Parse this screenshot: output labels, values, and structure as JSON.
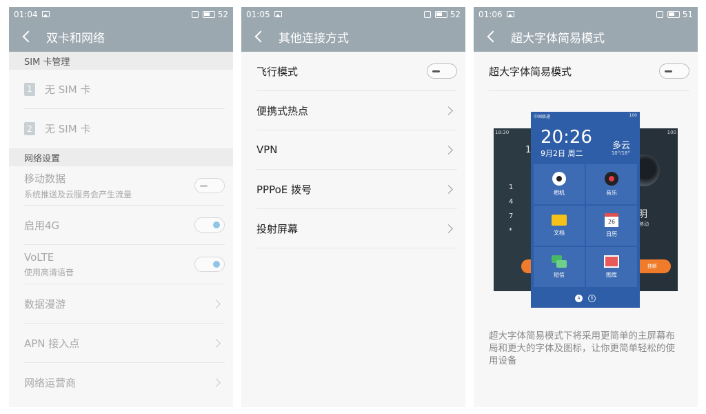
{
  "screens": [
    {
      "status": {
        "time": "01:04",
        "battery": "52"
      },
      "title": "双卡和网络",
      "sim_section": "SIM 卡管理",
      "sims": [
        {
          "slot": "1",
          "label": "无 SIM 卡"
        },
        {
          "slot": "2",
          "label": "无 SIM 卡"
        }
      ],
      "network_section": "网络设置",
      "items": [
        {
          "label": "移动数据",
          "sub": "系统推送及云服务会产生流量",
          "control": "toggle-off"
        },
        {
          "label": "启用4G",
          "control": "toggle-on"
        },
        {
          "label": "VoLTE",
          "sub": "使用高清语音",
          "control": "toggle-on"
        },
        {
          "label": "数据漫游",
          "control": "chevron"
        },
        {
          "label": "APN 接入点",
          "control": "chevron"
        },
        {
          "label": "网络运营商",
          "control": "chevron"
        }
      ]
    },
    {
      "status": {
        "time": "01:05",
        "battery": "52"
      },
      "title": "其他连接方式",
      "items": [
        {
          "label": "飞行模式",
          "control": "toggle-off"
        },
        {
          "label": "便携式热点",
          "control": "chevron"
        },
        {
          "label": "VPN",
          "control": "chevron"
        },
        {
          "label": "PPPoE 拨号",
          "control": "chevron"
        },
        {
          "label": "投射屏幕",
          "control": "chevron"
        }
      ]
    },
    {
      "status": {
        "time": "01:06",
        "battery": "51"
      },
      "title": "超大字体简易模式",
      "toggle_label": "超大字体简易模式",
      "preview": {
        "carrier": "中国联通",
        "signal": "100",
        "clock": "20:26",
        "date": "9月2日 周二",
        "weather": "多云",
        "temp": "10°/18°",
        "tiles": [
          {
            "label": "相机",
            "icon": "camera-icon"
          },
          {
            "label": "音乐",
            "icon": "music-icon"
          },
          {
            "label": "文档",
            "icon": "folder-icon"
          },
          {
            "label": "日历",
            "icon": "calendar-icon",
            "day": "26"
          },
          {
            "label": "短信",
            "icon": "message-icon"
          },
          {
            "label": "图库",
            "icon": "gallery-icon"
          }
        ],
        "dots": [
          "A",
          "B"
        ],
        "left_phone": {
          "time": "18:30",
          "digits": [
            "1",
            "4",
            "7",
            "*"
          ],
          "partial": "1"
        },
        "right_phone": {
          "signal": "100",
          "partial_name": "明",
          "partial_sub": "移动",
          "hangup": "挂断"
        }
      },
      "description": "超大字体简易模式下将采用更简单的主屏幕布局和更大的字体及图标，让你更简单轻松的使用设备"
    }
  ],
  "colors": {
    "header": "#9ca8b0",
    "accent_on": "#8fc6e8",
    "tile_blue": "#3d6bb4",
    "call_orange": "#f07b2a"
  }
}
